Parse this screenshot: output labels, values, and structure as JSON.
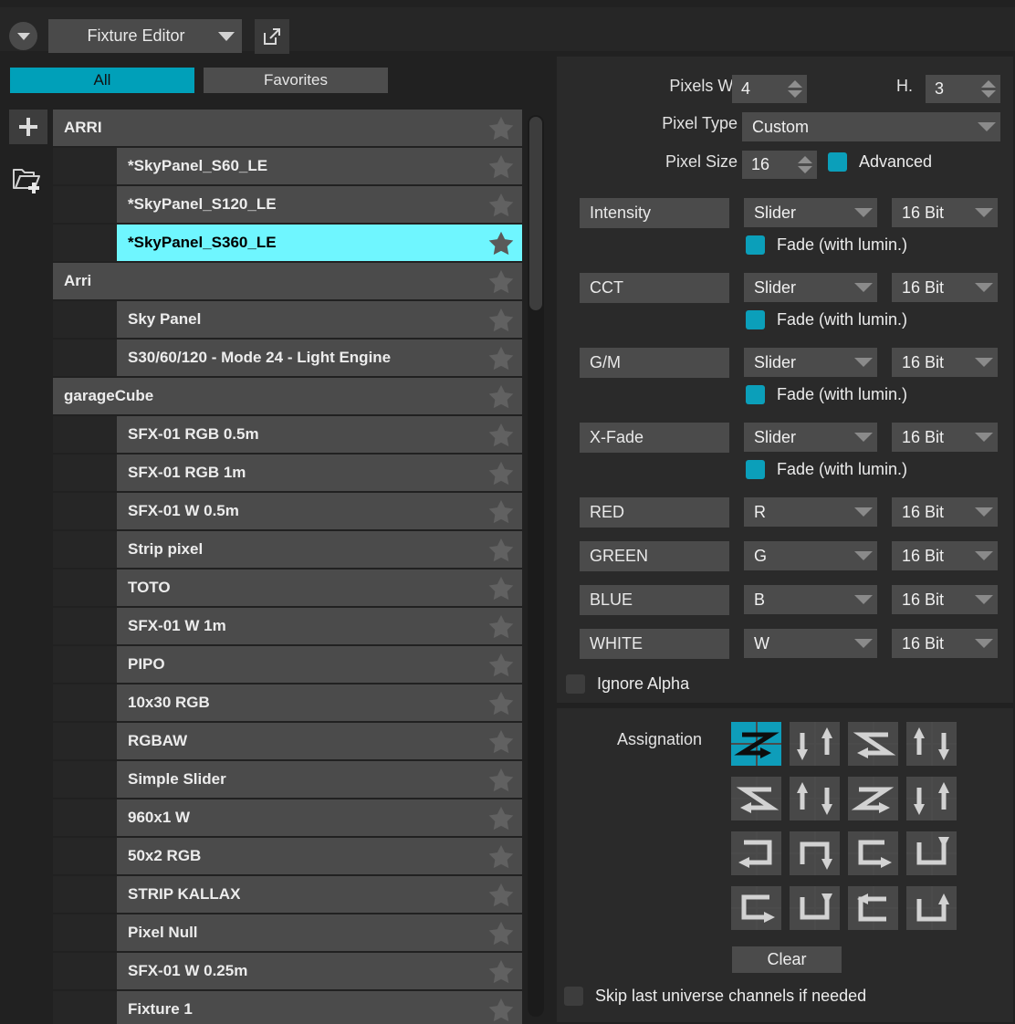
{
  "topbar": {
    "dropdown_button_icon": "chevron-down-icon",
    "module_select": "Fixture Editor",
    "popout_icon": "external-link-icon"
  },
  "tabs": [
    {
      "label": "All",
      "active": true
    },
    {
      "label": "Favorites",
      "active": false
    }
  ],
  "sidetools": {
    "add_label": "+",
    "add_icon": "plus-icon",
    "folder_icon": "folder-add-icon"
  },
  "fixture_list": [
    {
      "type": "group",
      "label": "ARRI",
      "favorite": false
    },
    {
      "type": "item",
      "label": "*SkyPanel_S60_LE",
      "favorite": false
    },
    {
      "type": "item",
      "label": "*SkyPanel_S120_LE",
      "favorite": false
    },
    {
      "type": "item",
      "label": "*SkyPanel_S360_LE",
      "favorite": true,
      "selected": true
    },
    {
      "type": "group",
      "label": "Arri",
      "favorite": false
    },
    {
      "type": "item",
      "label": "Sky Panel",
      "favorite": false
    },
    {
      "type": "item",
      "label": "S30/60/120 - Mode 24 - Light Engine",
      "favorite": false
    },
    {
      "type": "group",
      "label": "garageCube",
      "favorite": false
    },
    {
      "type": "item",
      "label": "SFX-01 RGB 0.5m",
      "favorite": false
    },
    {
      "type": "item",
      "label": "SFX-01 RGB 1m",
      "favorite": false
    },
    {
      "type": "item",
      "label": "SFX-01 W 0.5m",
      "favorite": false
    },
    {
      "type": "item",
      "label": "Strip pixel",
      "favorite": false
    },
    {
      "type": "item",
      "label": "TOTO",
      "favorite": false
    },
    {
      "type": "item",
      "label": "SFX-01 W 1m",
      "favorite": false
    },
    {
      "type": "item",
      "label": "PIPO",
      "favorite": false
    },
    {
      "type": "item",
      "label": "10x30 RGB",
      "favorite": false
    },
    {
      "type": "item",
      "label": "RGBAW",
      "favorite": false
    },
    {
      "type": "item",
      "label": "Simple Slider",
      "favorite": false
    },
    {
      "type": "item",
      "label": "960x1 W",
      "favorite": false
    },
    {
      "type": "item",
      "label": "50x2 RGB",
      "favorite": false
    },
    {
      "type": "item",
      "label": "STRIP KALLAX",
      "favorite": false
    },
    {
      "type": "item",
      "label": "Pixel Null",
      "favorite": false
    },
    {
      "type": "item",
      "label": "SFX-01 W 0.25m",
      "favorite": false
    },
    {
      "type": "item",
      "label": "Fixture 1",
      "favorite": false
    }
  ],
  "editor": {
    "pixels_w_label": "Pixels W:",
    "pixels_w_value": "4",
    "pixels_h_label": "H.",
    "pixels_h_value": "3",
    "pixel_type_label": "Pixel Type",
    "pixel_type_value": "Custom",
    "pixel_size_label": "Pixel Size",
    "pixel_size_value": "16",
    "advanced_label": "Advanced",
    "advanced_checked": true,
    "fade_label": "Fade (with lumin.)",
    "channels": [
      {
        "name": "Intensity",
        "mode": "Slider",
        "depth": "16 Bit",
        "fade": true,
        "fade_checked": true
      },
      {
        "name": "CCT",
        "mode": "Slider",
        "depth": "16 Bit",
        "fade": true,
        "fade_checked": true
      },
      {
        "name": "G/M",
        "mode": "Slider",
        "depth": "16 Bit",
        "fade": true,
        "fade_checked": true
      },
      {
        "name": "X-Fade",
        "mode": "Slider",
        "depth": "16 Bit",
        "fade": true,
        "fade_checked": true
      },
      {
        "name": "RED",
        "mode": "R",
        "depth": "16 Bit",
        "fade": false,
        "fade_checked": false
      },
      {
        "name": "GREEN",
        "mode": "G",
        "depth": "16 Bit",
        "fade": false,
        "fade_checked": false
      },
      {
        "name": "BLUE",
        "mode": "B",
        "depth": "16 Bit",
        "fade": false,
        "fade_checked": false
      },
      {
        "name": "WHITE",
        "mode": "W",
        "depth": "16 Bit",
        "fade": false,
        "fade_checked": false
      }
    ],
    "ignore_alpha_label": "Ignore Alpha",
    "ignore_alpha_checked": false
  },
  "assignation": {
    "label": "Assignation",
    "selected_index": 0,
    "patterns": [
      "snake-right-down-start-topleft",
      "snake-down-right-start-topleft",
      "snake-left-down-start-topright",
      "snake-down-left-start-bottomleft",
      "snake-left-up-start-bottomright",
      "snake-up-right-start-bottomleft",
      "snake-right-up-start-bottomleft",
      "snake-down-start-topleft-alt",
      "boustro-left-start-topright",
      "boustro-up-start-bottomleft",
      "boustro-right-start-topleft",
      "boustro-down-start-topleft",
      "boustro-right-start-bottomleft",
      "boustro-down-start-topright",
      "boustro-left-start-bottomright",
      "boustro-up-start-bottomright"
    ],
    "clear_label": "Clear",
    "skip_label": "Skip last universe channels if needed",
    "skip_checked": false
  },
  "colors": {
    "accent": "#00a0b9",
    "selection": "#6ff6ff",
    "panel": "#2a2a2a",
    "field": "#4b4b4b"
  }
}
